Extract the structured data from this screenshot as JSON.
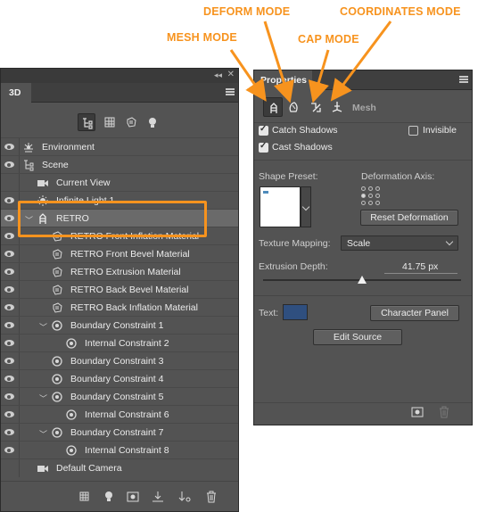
{
  "callouts": {
    "deform": "DEFORM MODE",
    "coordinates": "COORDINATES MODE",
    "mesh": "MESH MODE",
    "cap": "CAP MODE"
  },
  "panel3d": {
    "tab_label": "3D",
    "collapse_glyph": "◂◂",
    "close_glyph": "✕",
    "rows": [
      {
        "label": "Environment",
        "icon": "environment-icon"
      },
      {
        "label": "Scene",
        "icon": "scene-icon"
      },
      {
        "label": "Current View",
        "icon": "camera-icon"
      },
      {
        "label": "Infinite Light 1",
        "icon": "light-icon"
      },
      {
        "label": "RETRO",
        "icon": "mesh-icon"
      },
      {
        "label": "RETRO Front Inflation Material",
        "icon": "material-icon"
      },
      {
        "label": "RETRO Front Bevel Material",
        "icon": "material-icon"
      },
      {
        "label": "RETRO Extrusion Material",
        "icon": "material-icon"
      },
      {
        "label": "RETRO Back Bevel Material",
        "icon": "material-icon"
      },
      {
        "label": "RETRO Back Inflation Material",
        "icon": "material-icon"
      },
      {
        "label": "Boundary Constraint 1",
        "icon": "constraint-icon"
      },
      {
        "label": "Internal Constraint 2",
        "icon": "constraint-icon"
      },
      {
        "label": "Boundary Constraint 3",
        "icon": "constraint-icon"
      },
      {
        "label": "Boundary Constraint 4",
        "icon": "constraint-icon"
      },
      {
        "label": "Boundary Constraint 5",
        "icon": "constraint-icon"
      },
      {
        "label": "Internal Constraint 6",
        "icon": "constraint-icon"
      },
      {
        "label": "Boundary Constraint 7",
        "icon": "constraint-icon"
      },
      {
        "label": "Internal Constraint 8",
        "icon": "constraint-icon"
      },
      {
        "label": "Default Camera",
        "icon": "camera-icon"
      }
    ],
    "selected_row": "RETRO"
  },
  "properties": {
    "tab_label": "Properties",
    "mode_label": "Mesh",
    "catch_shadows": "Catch Shadows",
    "invisible": "Invisible",
    "cast_shadows": "Cast Shadows",
    "shape_preset_label": "Shape Preset:",
    "deformation_axis_label": "Deformation Axis:",
    "reset_deformation": "Reset Deformation",
    "texture_mapping_label": "Texture Mapping:",
    "texture_mapping_value": "Scale",
    "extrusion_depth_label": "Extrusion Depth:",
    "extrusion_depth_value": "41.75 px",
    "extrusion_depth_level": 0.5,
    "text_label": "Text:",
    "text_color": "#2f4f7f",
    "character_panel": "Character Panel",
    "edit_source": "Edit Source",
    "catch_shadows_checked": true,
    "cast_shadows_checked": true,
    "invisible_checked": false
  },
  "colors": {
    "accent": "#f7931e",
    "panel_bg": "#535353"
  }
}
